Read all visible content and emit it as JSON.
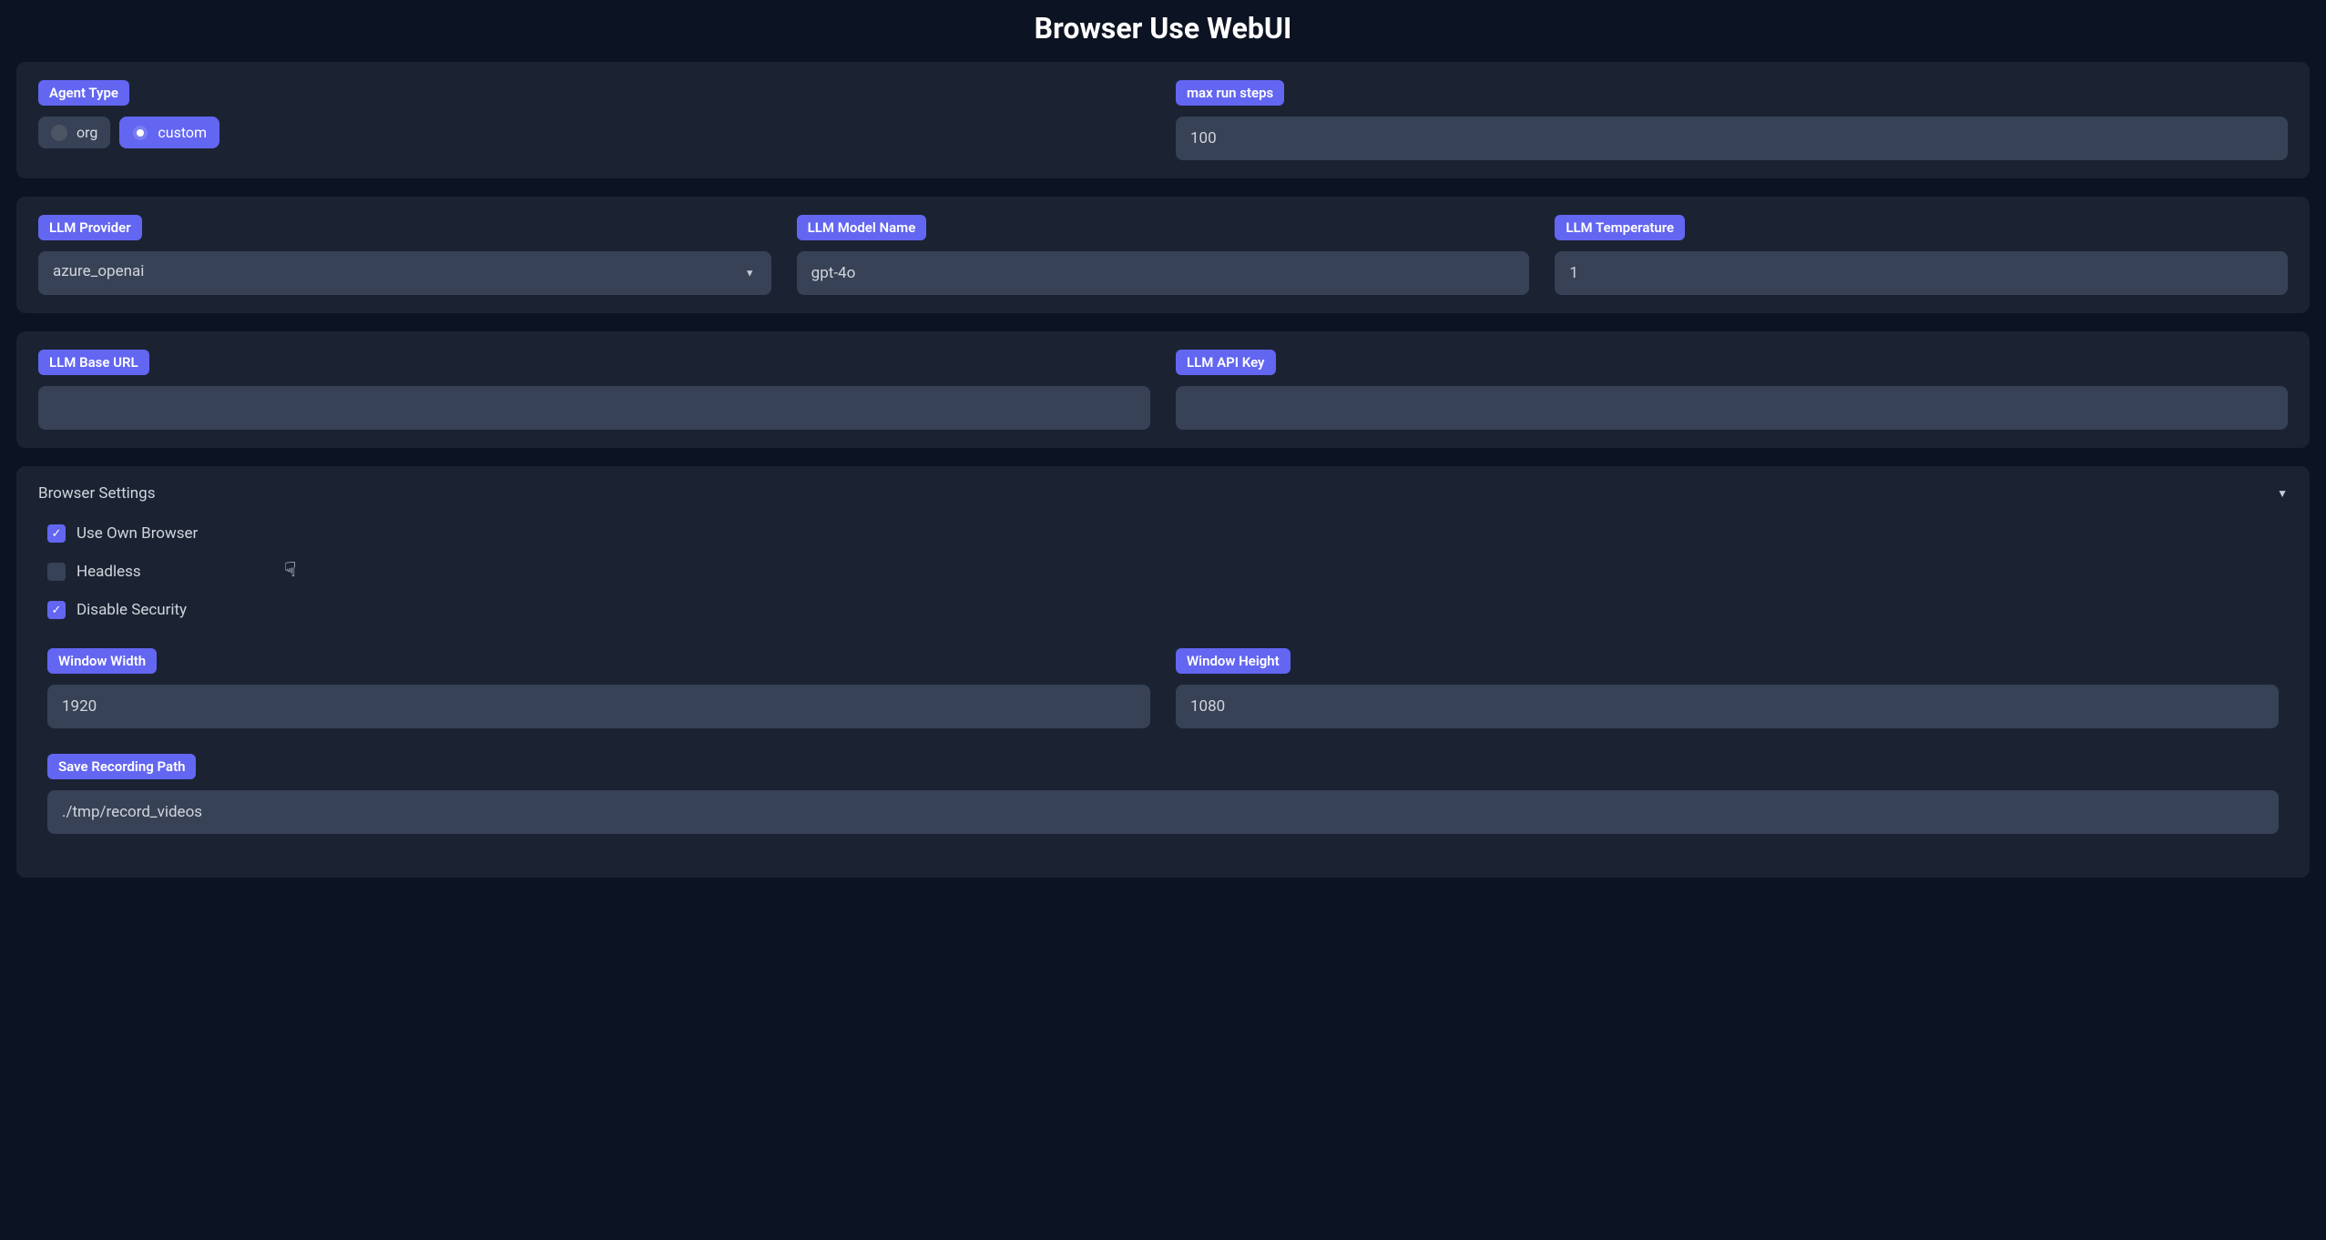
{
  "title": "Browser Use WebUI",
  "agent_type": {
    "label": "Agent Type",
    "options": {
      "org": "org",
      "custom": "custom"
    },
    "selected": "custom"
  },
  "max_run_steps": {
    "label": "max run steps",
    "value": "100"
  },
  "llm_provider": {
    "label": "LLM Provider",
    "value": "azure_openai"
  },
  "llm_model_name": {
    "label": "LLM Model Name",
    "value": "gpt-4o"
  },
  "llm_temperature": {
    "label": "LLM Temperature",
    "value": "1"
  },
  "llm_base_url": {
    "label": "LLM Base URL",
    "value": ""
  },
  "llm_api_key": {
    "label": "LLM API Key",
    "value": ""
  },
  "browser_settings": {
    "title": "Browser Settings",
    "checks": {
      "use_own_browser": {
        "label": "Use Own Browser",
        "checked": true
      },
      "headless": {
        "label": "Headless",
        "checked": false
      },
      "disable_security": {
        "label": "Disable Security",
        "checked": true
      }
    },
    "window_width": {
      "label": "Window Width",
      "value": "1920"
    },
    "window_height": {
      "label": "Window Height",
      "value": "1080"
    },
    "save_recording_path": {
      "label": "Save Recording Path",
      "value": "./tmp/record_videos"
    }
  }
}
